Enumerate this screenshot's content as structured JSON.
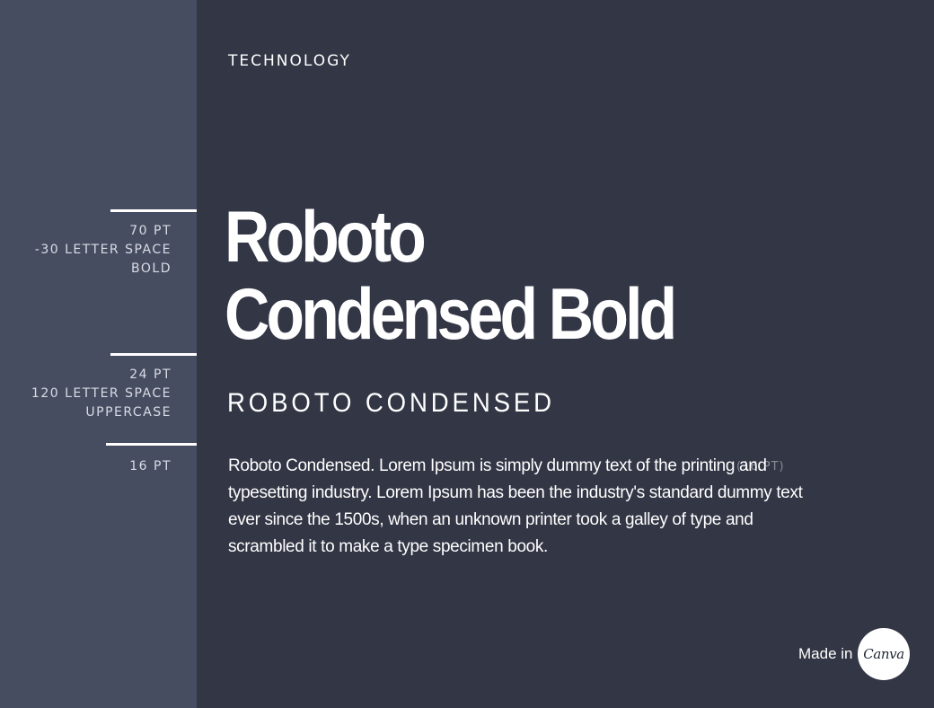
{
  "page": {
    "category": "TECHNOLOGY",
    "headline_lines": [
      "Roboto",
      "Condensed Bold"
    ],
    "subheading": "ROBOTO CONDENSED",
    "body_text": "Roboto Condensed. Lorem Ipsum is simply dummy text of the printing and typesetting industry. Lorem Ipsum has been the industry's standard dummy text ever since the 1500s, when an unknown printer took a galley of type and scrambled it to make a type specimen book.",
    "overlay_note": "(16 PT)"
  },
  "sidebar": {
    "specs": [
      {
        "lines": [
          "70 PT",
          "-30 LETTER SPACE",
          "BOLD"
        ]
      },
      {
        "lines": [
          "24 PT",
          "120 LETTER SPACE",
          "UPPERCASE"
        ]
      },
      {
        "lines": [
          "16 PT"
        ]
      }
    ]
  },
  "footer": {
    "made_in_label": "Made in",
    "logo_text": "Canva"
  },
  "colors": {
    "background": "#323645",
    "sidebar": "#474d60",
    "text": "#ffffff",
    "secondary_text": "#d9dce6"
  }
}
